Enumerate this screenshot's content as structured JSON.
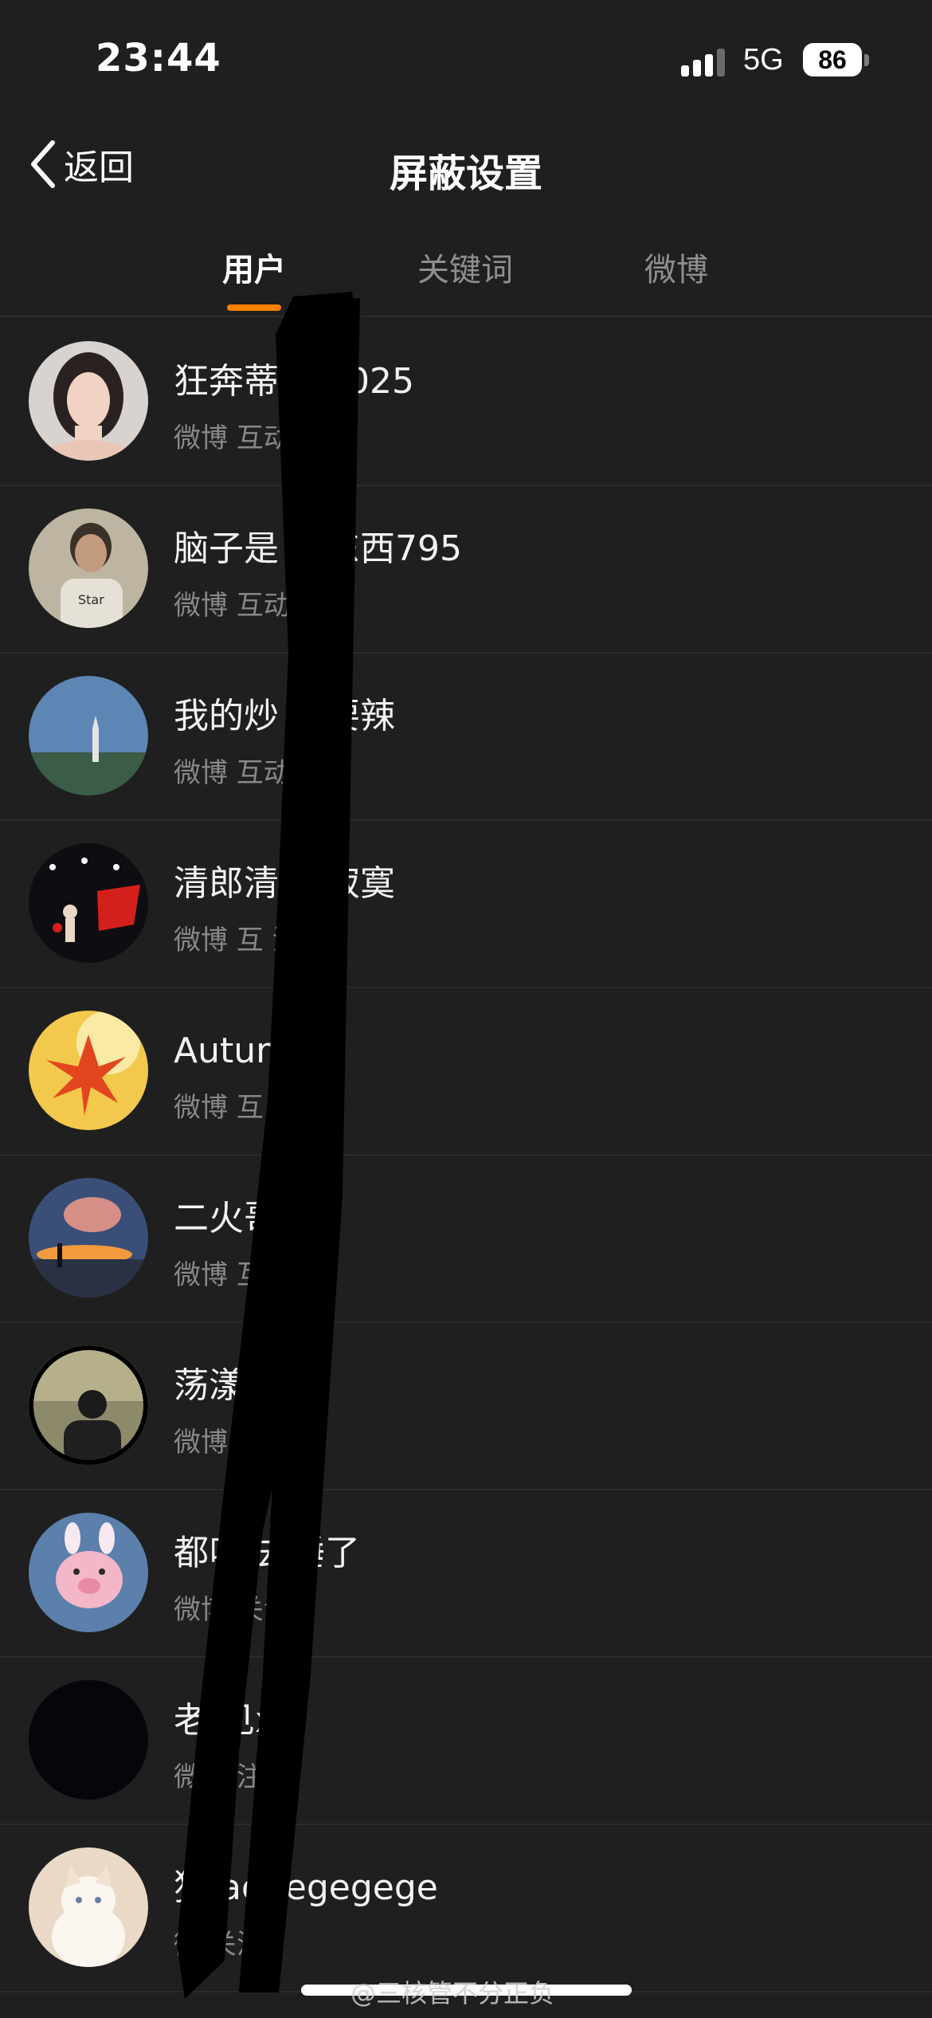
{
  "status_bar": {
    "time": "23:44",
    "network": "5G",
    "battery": "86"
  },
  "nav": {
    "back_label": "返回",
    "title": "屏蔽设置"
  },
  "tabs": [
    {
      "label": "用户",
      "active": true
    },
    {
      "label": "关键词",
      "active": false
    },
    {
      "label": "微博",
      "active": false
    }
  ],
  "users": [
    {
      "name": "狂奔蒂  丰2025",
      "meta": "微博 互动  注",
      "avatar": "portrait-woman"
    },
    {
      "name": "脑子是  好东西795",
      "meta": "微博 互动  注",
      "avatar": "portrait-man-tshirt"
    },
    {
      "name": "我的炒  不要辣",
      "meta": "微博 互动  注",
      "avatar": "tower-landscape"
    },
    {
      "name": "清郎清  个寂寞",
      "meta": "微博 互  注",
      "avatar": "flag-illustration"
    },
    {
      "name": "Autum  邱",
      "meta": "微博 互  关注",
      "avatar": "maple-leaf"
    },
    {
      "name": "二火哥",
      "meta": "微博 互  关注",
      "avatar": "sunset-beach"
    },
    {
      "name": "荡漾  娃",
      "meta": "微博    关注",
      "avatar": "man-back-landscape"
    },
    {
      "name": "都叫  去睡了",
      "meta": "微博    关注",
      "avatar": "pink-pig"
    },
    {
      "name": "老    见xy",
      "meta": "微     关注",
      "avatar": "dark-blank"
    },
    {
      "name": "狗    aogegegege",
      "meta": "微     关注",
      "avatar": "white-cat"
    }
  ],
  "watermark": "@三核管不分正负",
  "colors": {
    "background": "#1f1f1f",
    "accent": "#ff8200",
    "divider": "#2b2b2b",
    "secondary_text": "#888888"
  }
}
